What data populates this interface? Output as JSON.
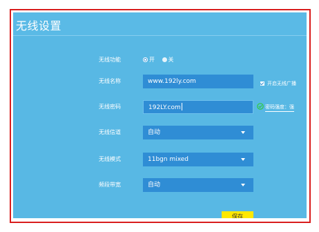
{
  "header": {
    "title": "无线设置"
  },
  "wireless": {
    "function_label": "无线功能",
    "options": [
      {
        "label": "开",
        "selected": true
      },
      {
        "label": "关",
        "selected": false
      }
    ],
    "ssid_label": "无线名称",
    "ssid_value": "www.192ly.com",
    "broadcast_label": "开启无线广播",
    "broadcast_checked": true,
    "password_label": "无线密码",
    "password_value": "192LY.com",
    "strength_text": "密码强度：强",
    "channel_label": "无线信道",
    "channel_value": "自动",
    "mode_label": "无线模式",
    "mode_value": "11bgn mixed",
    "bandwidth_label": "频段带宽",
    "bandwidth_value": "自动",
    "save_label": "保存"
  },
  "colors": {
    "panel": "#58b8e4",
    "field": "#2f8dd5",
    "border": "#d91c1c",
    "save": "#ffe800",
    "ok": "#2ecc40"
  },
  "icons": {
    "check": "check-circle-icon",
    "dropdown": "chevron-down-icon"
  }
}
